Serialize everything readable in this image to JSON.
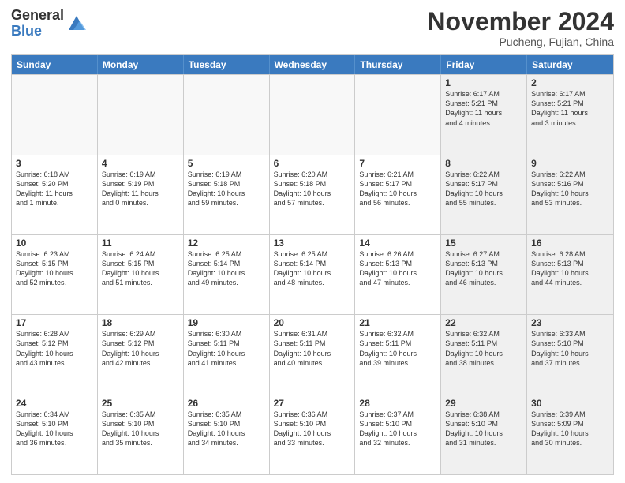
{
  "header": {
    "logo_general": "General",
    "logo_blue": "Blue",
    "month_title": "November 2024",
    "location": "Pucheng, Fujian, China"
  },
  "calendar": {
    "days_of_week": [
      "Sunday",
      "Monday",
      "Tuesday",
      "Wednesday",
      "Thursday",
      "Friday",
      "Saturday"
    ],
    "rows": [
      [
        {
          "day": "",
          "info": "",
          "empty": true
        },
        {
          "day": "",
          "info": "",
          "empty": true
        },
        {
          "day": "",
          "info": "",
          "empty": true
        },
        {
          "day": "",
          "info": "",
          "empty": true
        },
        {
          "day": "",
          "info": "",
          "empty": true
        },
        {
          "day": "1",
          "info": "Sunrise: 6:17 AM\nSunset: 5:21 PM\nDaylight: 11 hours\nand 4 minutes.",
          "shaded": true
        },
        {
          "day": "2",
          "info": "Sunrise: 6:17 AM\nSunset: 5:21 PM\nDaylight: 11 hours\nand 3 minutes.",
          "shaded": true
        }
      ],
      [
        {
          "day": "3",
          "info": "Sunrise: 6:18 AM\nSunset: 5:20 PM\nDaylight: 11 hours\nand 1 minute."
        },
        {
          "day": "4",
          "info": "Sunrise: 6:19 AM\nSunset: 5:19 PM\nDaylight: 11 hours\nand 0 minutes."
        },
        {
          "day": "5",
          "info": "Sunrise: 6:19 AM\nSunset: 5:18 PM\nDaylight: 10 hours\nand 59 minutes."
        },
        {
          "day": "6",
          "info": "Sunrise: 6:20 AM\nSunset: 5:18 PM\nDaylight: 10 hours\nand 57 minutes."
        },
        {
          "day": "7",
          "info": "Sunrise: 6:21 AM\nSunset: 5:17 PM\nDaylight: 10 hours\nand 56 minutes."
        },
        {
          "day": "8",
          "info": "Sunrise: 6:22 AM\nSunset: 5:17 PM\nDaylight: 10 hours\nand 55 minutes.",
          "shaded": true
        },
        {
          "day": "9",
          "info": "Sunrise: 6:22 AM\nSunset: 5:16 PM\nDaylight: 10 hours\nand 53 minutes.",
          "shaded": true
        }
      ],
      [
        {
          "day": "10",
          "info": "Sunrise: 6:23 AM\nSunset: 5:15 PM\nDaylight: 10 hours\nand 52 minutes."
        },
        {
          "day": "11",
          "info": "Sunrise: 6:24 AM\nSunset: 5:15 PM\nDaylight: 10 hours\nand 51 minutes."
        },
        {
          "day": "12",
          "info": "Sunrise: 6:25 AM\nSunset: 5:14 PM\nDaylight: 10 hours\nand 49 minutes."
        },
        {
          "day": "13",
          "info": "Sunrise: 6:25 AM\nSunset: 5:14 PM\nDaylight: 10 hours\nand 48 minutes."
        },
        {
          "day": "14",
          "info": "Sunrise: 6:26 AM\nSunset: 5:13 PM\nDaylight: 10 hours\nand 47 minutes."
        },
        {
          "day": "15",
          "info": "Sunrise: 6:27 AM\nSunset: 5:13 PM\nDaylight: 10 hours\nand 46 minutes.",
          "shaded": true
        },
        {
          "day": "16",
          "info": "Sunrise: 6:28 AM\nSunset: 5:13 PM\nDaylight: 10 hours\nand 44 minutes.",
          "shaded": true
        }
      ],
      [
        {
          "day": "17",
          "info": "Sunrise: 6:28 AM\nSunset: 5:12 PM\nDaylight: 10 hours\nand 43 minutes."
        },
        {
          "day": "18",
          "info": "Sunrise: 6:29 AM\nSunset: 5:12 PM\nDaylight: 10 hours\nand 42 minutes."
        },
        {
          "day": "19",
          "info": "Sunrise: 6:30 AM\nSunset: 5:11 PM\nDaylight: 10 hours\nand 41 minutes."
        },
        {
          "day": "20",
          "info": "Sunrise: 6:31 AM\nSunset: 5:11 PM\nDaylight: 10 hours\nand 40 minutes."
        },
        {
          "day": "21",
          "info": "Sunrise: 6:32 AM\nSunset: 5:11 PM\nDaylight: 10 hours\nand 39 minutes."
        },
        {
          "day": "22",
          "info": "Sunrise: 6:32 AM\nSunset: 5:11 PM\nDaylight: 10 hours\nand 38 minutes.",
          "shaded": true
        },
        {
          "day": "23",
          "info": "Sunrise: 6:33 AM\nSunset: 5:10 PM\nDaylight: 10 hours\nand 37 minutes.",
          "shaded": true
        }
      ],
      [
        {
          "day": "24",
          "info": "Sunrise: 6:34 AM\nSunset: 5:10 PM\nDaylight: 10 hours\nand 36 minutes."
        },
        {
          "day": "25",
          "info": "Sunrise: 6:35 AM\nSunset: 5:10 PM\nDaylight: 10 hours\nand 35 minutes."
        },
        {
          "day": "26",
          "info": "Sunrise: 6:35 AM\nSunset: 5:10 PM\nDaylight: 10 hours\nand 34 minutes."
        },
        {
          "day": "27",
          "info": "Sunrise: 6:36 AM\nSunset: 5:10 PM\nDaylight: 10 hours\nand 33 minutes."
        },
        {
          "day": "28",
          "info": "Sunrise: 6:37 AM\nSunset: 5:10 PM\nDaylight: 10 hours\nand 32 minutes."
        },
        {
          "day": "29",
          "info": "Sunrise: 6:38 AM\nSunset: 5:10 PM\nDaylight: 10 hours\nand 31 minutes.",
          "shaded": true
        },
        {
          "day": "30",
          "info": "Sunrise: 6:39 AM\nSunset: 5:09 PM\nDaylight: 10 hours\nand 30 minutes.",
          "shaded": true
        }
      ]
    ]
  }
}
